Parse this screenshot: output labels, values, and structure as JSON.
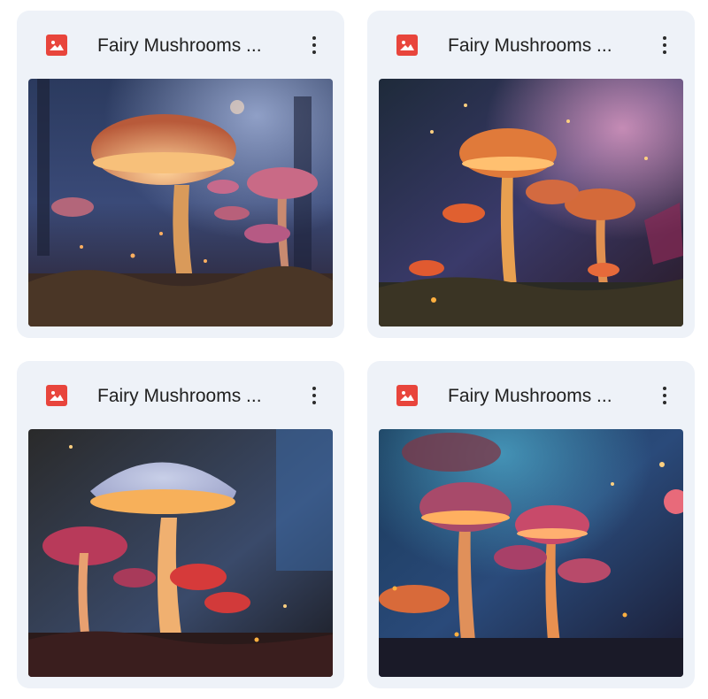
{
  "files": [
    {
      "title": "Fairy Mushrooms ...",
      "icon": "image-file-icon",
      "thumbnail": "fairy mushrooms thumbnail"
    },
    {
      "title": "Fairy Mushrooms ...",
      "icon": "image-file-icon",
      "thumbnail": "fairy mushrooms thumbnail"
    },
    {
      "title": "Fairy Mushrooms ...",
      "icon": "image-file-icon",
      "thumbnail": "fairy mushrooms thumbnail"
    },
    {
      "title": "Fairy Mushrooms ...",
      "icon": "image-file-icon",
      "thumbnail": "fairy mushrooms thumbnail"
    }
  ],
  "colors": {
    "card_bg": "#eef2f8",
    "icon_red": "#e8453c",
    "text": "#1f1f1f"
  }
}
